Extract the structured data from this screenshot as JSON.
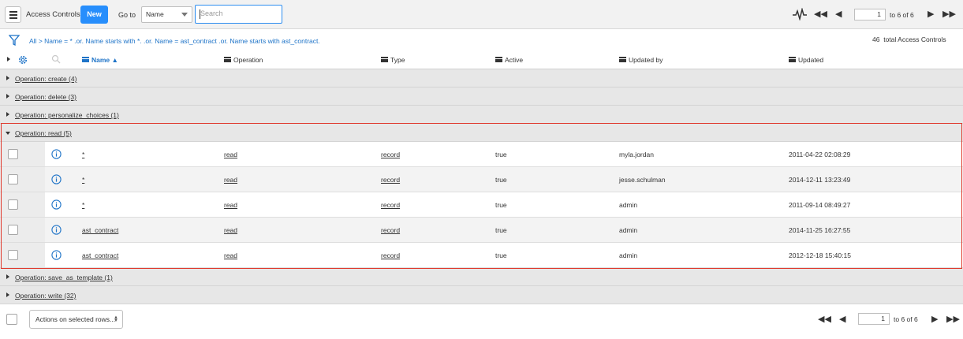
{
  "header": {
    "title": "Access Controls",
    "new_label": "New",
    "goto_label": "Go to",
    "goto_field": "Name",
    "search_placeholder": "Search",
    "page_value": "1",
    "page_of": "to 6 of 6"
  },
  "filter": {
    "all": "All",
    "sep": " > ",
    "text": "Name = * .or. Name starts with *. .or. Name = ast_contract .or. Name starts with ast_contract.",
    "total_count": "46",
    "total_label": "total Access Controls"
  },
  "columns": {
    "name": "Name",
    "operation": "Operation",
    "type": "Type",
    "active": "Active",
    "updated_by": "Updated by",
    "updated": "Updated"
  },
  "groups": [
    {
      "label": "Operation: create (4)"
    },
    {
      "label": "Operation: delete (3)"
    },
    {
      "label": "Operation: personalize_choices (1)"
    },
    {
      "label": "Operation: read (5)"
    },
    {
      "label": "Operation: save_as_template (1)"
    },
    {
      "label": "Operation: write (32)"
    }
  ],
  "rows": [
    {
      "name": "*",
      "operation": "read",
      "type": "record",
      "active": "true",
      "updated_by": "myla.jordan",
      "updated": "2011-04-22 02:08:29"
    },
    {
      "name": "*",
      "operation": "read",
      "type": "record",
      "active": "true",
      "updated_by": "jesse.schulman",
      "updated": "2014-12-11 13:23:49"
    },
    {
      "name": "*",
      "operation": "read",
      "type": "record",
      "active": "true",
      "updated_by": "admin",
      "updated": "2011-09-14 08:49:27"
    },
    {
      "name": "ast_contract",
      "operation": "read",
      "type": "record",
      "active": "true",
      "updated_by": "admin",
      "updated": "2014-11-25 16:27:55"
    },
    {
      "name": "ast_contract",
      "operation": "read",
      "type": "record",
      "active": "true",
      "updated_by": "admin",
      "updated": "2012-12-18 15:40:15"
    }
  ],
  "footer": {
    "actions_label": "Actions on selected rows...",
    "page_value": "1",
    "page_of": "to 6 of 6"
  },
  "colors": {
    "accent": "#278efc",
    "highlight": "#e0392d",
    "link": "#1f74c8"
  }
}
